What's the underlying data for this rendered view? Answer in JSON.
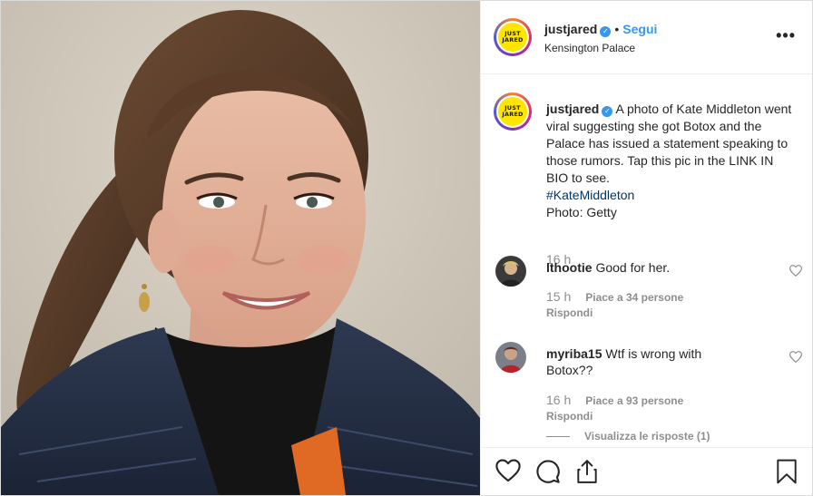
{
  "header": {
    "logo_line1": "JUST",
    "logo_line2": "JARED",
    "username": "justjared",
    "verified_mark": "✓",
    "separator": "•",
    "follow_label": "Segui",
    "location": "Kensington Palace",
    "more_label": "•••",
    "more_icon": "more-horizontal-icon"
  },
  "caption": {
    "username": "justjared",
    "text": "A photo of Kate Middleton went viral suggesting she got Botox and the Palace has issued a statement speaking to those rumors. Tap this pic in the LINK IN BIO to see.",
    "hashtag": "#KateMiddleton",
    "credit": "Photo: Getty",
    "time": "16 h"
  },
  "comments": [
    {
      "username": "lthootie",
      "text": "Good for her.",
      "time": "15 h",
      "likes": "Piace a 34 persone",
      "reply_label": "Rispondi"
    },
    {
      "username": "myriba15",
      "text": "Wtf is wrong with Botox??",
      "time": "16 h",
      "likes": "Piace a 93 persone",
      "reply_label": "Rispondi"
    }
  ],
  "view_replies": "Visualizza le risposte (1)",
  "actions": {
    "icons": [
      "heart-icon",
      "comment-icon",
      "share-icon",
      "bookmark-icon"
    ]
  },
  "colors": {
    "accent": "#3897f0",
    "hashtag": "#003569",
    "muted": "#8e8e8e",
    "text": "#262626",
    "logo_yellow": "#ffe600"
  }
}
